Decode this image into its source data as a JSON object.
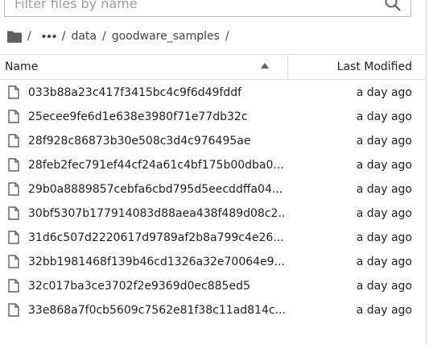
{
  "filter": {
    "placeholder": "Filter files by name",
    "icon": "search-icon"
  },
  "breadcrumbs": {
    "root_icon": "folder-icon",
    "separator": "/",
    "ellipsis_icon": "ellipsis-icon",
    "items": [
      "data",
      "goodware_samples"
    ]
  },
  "header": {
    "name_label": "Name",
    "modified_label": "Last Modified",
    "sort_icon": "sort-ascending-icon"
  },
  "files": [
    {
      "name": "033b88a23c417f3415bc4c9f6d49fddf",
      "modified": "a day ago"
    },
    {
      "name": "25ecee9fe6d1e638e3980f71e77db32c",
      "modified": "a day ago"
    },
    {
      "name": "28f928c86873b30e508c3d4c976495ae",
      "modified": "a day ago"
    },
    {
      "name": "28feb2fec791ef44cf24a61c4bf175b00dba0...",
      "modified": "a day ago"
    },
    {
      "name": "29b0a8889857cebfa6cbd795d5eecddffa04...",
      "modified": "a day ago"
    },
    {
      "name": "30bf5307b177914083d88aea438f489d08c2...",
      "modified": "a day ago"
    },
    {
      "name": "31d6c507d2220617d9789af2b8a799c4e26...",
      "modified": "a day ago"
    },
    {
      "name": "32bb1981468f139b46cd1326a32e70064e9...",
      "modified": "a day ago"
    },
    {
      "name": "32c017ba3ce3702f2e9369d0ec885ed5",
      "modified": "a day ago"
    },
    {
      "name": "33e868a7f0cb5609c7562e81f38c11ad814c...",
      "modified": "a day ago"
    }
  ]
}
